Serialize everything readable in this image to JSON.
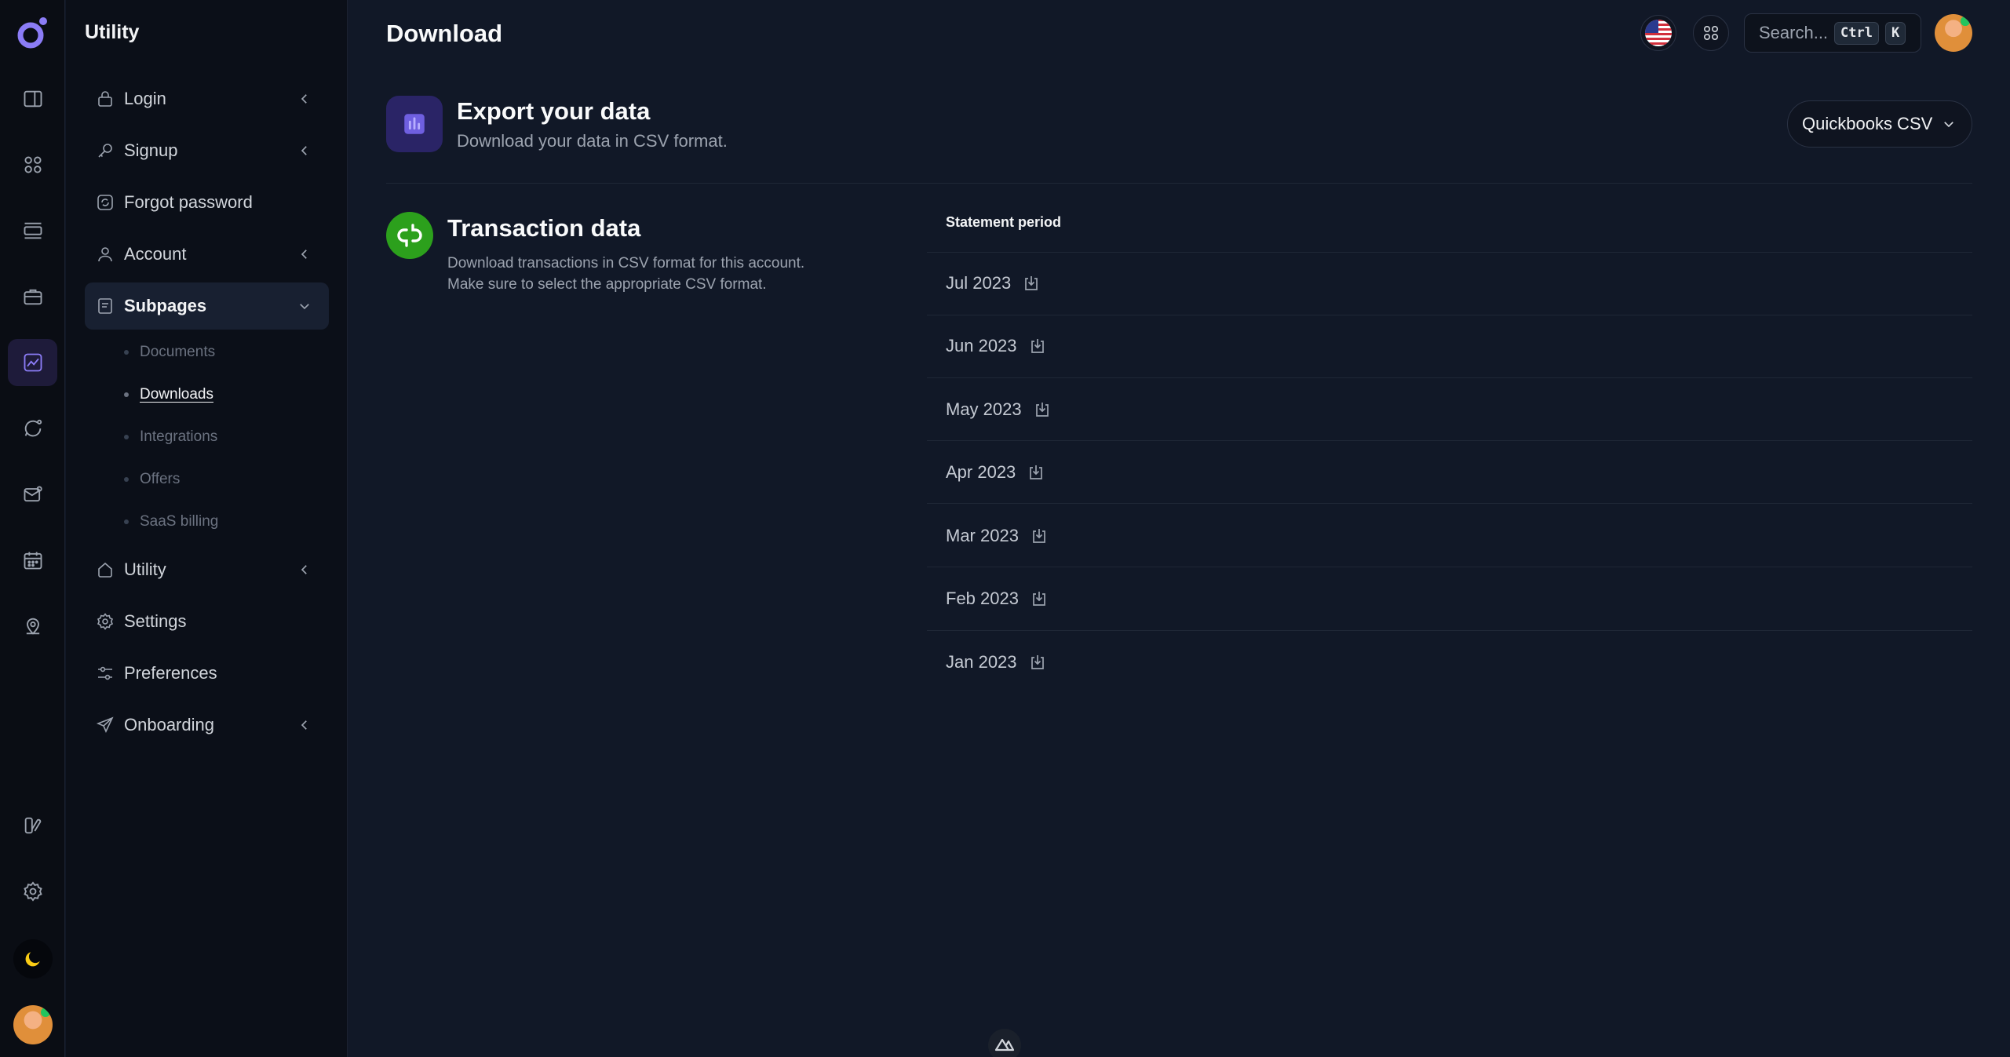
{
  "colors": {
    "background": "#111827",
    "sidebar": "#0b0f18",
    "accent": "#8b7cf6",
    "quickbooks": "#2ca01c"
  },
  "rail": {
    "items": [
      {
        "icon": "logo-icon"
      },
      {
        "icon": "sidebar-toggle-icon"
      },
      {
        "icon": "grid-icon"
      },
      {
        "icon": "layout-list-icon"
      },
      {
        "icon": "briefcase-icon"
      },
      {
        "icon": "chart-icon",
        "active": true
      },
      {
        "icon": "chat-icon"
      },
      {
        "icon": "mail-icon"
      },
      {
        "icon": "calendar-icon"
      },
      {
        "icon": "map-pin-icon"
      },
      {
        "icon": "customize-icon"
      },
      {
        "icon": "settings-icon"
      },
      {
        "icon": "moon-icon"
      },
      {
        "icon": "avatar"
      }
    ]
  },
  "sidebar": {
    "title": "Utility",
    "items": {
      "login": "Login",
      "signup": "Signup",
      "forgot": "Forgot password",
      "account": "Account",
      "subpages": "Subpages",
      "utility": "Utility",
      "settings": "Settings",
      "preferences": "Preferences",
      "onboarding": "Onboarding"
    },
    "subpages": {
      "documents": "Documents",
      "downloads": "Downloads",
      "integrations": "Integrations",
      "offers": "Offers",
      "saas_billing": "SaaS billing"
    },
    "active_subpage": "Downloads"
  },
  "header": {
    "title": "Download",
    "search_placeholder": "Search...",
    "kbd_ctrl": "Ctrl",
    "kbd_k": "K"
  },
  "export": {
    "title": "Export your data",
    "subtitle": "Download your data in CSV format.",
    "format_selected": "Quickbooks CSV"
  },
  "transactions": {
    "title": "Transaction data",
    "desc_line1": "Download transactions in CSV format for this account.",
    "desc_line2": "Make sure to select the appropriate CSV format.",
    "column_header": "Statement period",
    "periods": [
      "Jul 2023",
      "Jun 2023",
      "May 2023",
      "Apr 2023",
      "Mar 2023",
      "Feb 2023",
      "Jan 2023"
    ]
  }
}
